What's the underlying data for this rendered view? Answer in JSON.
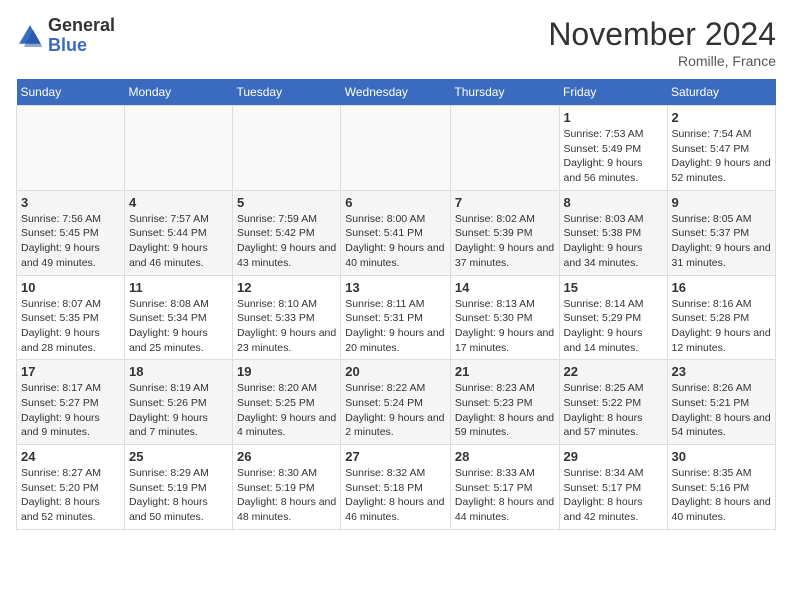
{
  "logo": {
    "general": "General",
    "blue": "Blue"
  },
  "header": {
    "month": "November 2024",
    "location": "Romille, France"
  },
  "weekdays": [
    "Sunday",
    "Monday",
    "Tuesday",
    "Wednesday",
    "Thursday",
    "Friday",
    "Saturday"
  ],
  "weeks": [
    [
      {
        "day": "",
        "info": ""
      },
      {
        "day": "",
        "info": ""
      },
      {
        "day": "",
        "info": ""
      },
      {
        "day": "",
        "info": ""
      },
      {
        "day": "",
        "info": ""
      },
      {
        "day": "1",
        "info": "Sunrise: 7:53 AM\nSunset: 5:49 PM\nDaylight: 9 hours and 56 minutes."
      },
      {
        "day": "2",
        "info": "Sunrise: 7:54 AM\nSunset: 5:47 PM\nDaylight: 9 hours and 52 minutes."
      }
    ],
    [
      {
        "day": "3",
        "info": "Sunrise: 7:56 AM\nSunset: 5:45 PM\nDaylight: 9 hours and 49 minutes."
      },
      {
        "day": "4",
        "info": "Sunrise: 7:57 AM\nSunset: 5:44 PM\nDaylight: 9 hours and 46 minutes."
      },
      {
        "day": "5",
        "info": "Sunrise: 7:59 AM\nSunset: 5:42 PM\nDaylight: 9 hours and 43 minutes."
      },
      {
        "day": "6",
        "info": "Sunrise: 8:00 AM\nSunset: 5:41 PM\nDaylight: 9 hours and 40 minutes."
      },
      {
        "day": "7",
        "info": "Sunrise: 8:02 AM\nSunset: 5:39 PM\nDaylight: 9 hours and 37 minutes."
      },
      {
        "day": "8",
        "info": "Sunrise: 8:03 AM\nSunset: 5:38 PM\nDaylight: 9 hours and 34 minutes."
      },
      {
        "day": "9",
        "info": "Sunrise: 8:05 AM\nSunset: 5:37 PM\nDaylight: 9 hours and 31 minutes."
      }
    ],
    [
      {
        "day": "10",
        "info": "Sunrise: 8:07 AM\nSunset: 5:35 PM\nDaylight: 9 hours and 28 minutes."
      },
      {
        "day": "11",
        "info": "Sunrise: 8:08 AM\nSunset: 5:34 PM\nDaylight: 9 hours and 25 minutes."
      },
      {
        "day": "12",
        "info": "Sunrise: 8:10 AM\nSunset: 5:33 PM\nDaylight: 9 hours and 23 minutes."
      },
      {
        "day": "13",
        "info": "Sunrise: 8:11 AM\nSunset: 5:31 PM\nDaylight: 9 hours and 20 minutes."
      },
      {
        "day": "14",
        "info": "Sunrise: 8:13 AM\nSunset: 5:30 PM\nDaylight: 9 hours and 17 minutes."
      },
      {
        "day": "15",
        "info": "Sunrise: 8:14 AM\nSunset: 5:29 PM\nDaylight: 9 hours and 14 minutes."
      },
      {
        "day": "16",
        "info": "Sunrise: 8:16 AM\nSunset: 5:28 PM\nDaylight: 9 hours and 12 minutes."
      }
    ],
    [
      {
        "day": "17",
        "info": "Sunrise: 8:17 AM\nSunset: 5:27 PM\nDaylight: 9 hours and 9 minutes."
      },
      {
        "day": "18",
        "info": "Sunrise: 8:19 AM\nSunset: 5:26 PM\nDaylight: 9 hours and 7 minutes."
      },
      {
        "day": "19",
        "info": "Sunrise: 8:20 AM\nSunset: 5:25 PM\nDaylight: 9 hours and 4 minutes."
      },
      {
        "day": "20",
        "info": "Sunrise: 8:22 AM\nSunset: 5:24 PM\nDaylight: 9 hours and 2 minutes."
      },
      {
        "day": "21",
        "info": "Sunrise: 8:23 AM\nSunset: 5:23 PM\nDaylight: 8 hours and 59 minutes."
      },
      {
        "day": "22",
        "info": "Sunrise: 8:25 AM\nSunset: 5:22 PM\nDaylight: 8 hours and 57 minutes."
      },
      {
        "day": "23",
        "info": "Sunrise: 8:26 AM\nSunset: 5:21 PM\nDaylight: 8 hours and 54 minutes."
      }
    ],
    [
      {
        "day": "24",
        "info": "Sunrise: 8:27 AM\nSunset: 5:20 PM\nDaylight: 8 hours and 52 minutes."
      },
      {
        "day": "25",
        "info": "Sunrise: 8:29 AM\nSunset: 5:19 PM\nDaylight: 8 hours and 50 minutes."
      },
      {
        "day": "26",
        "info": "Sunrise: 8:30 AM\nSunset: 5:19 PM\nDaylight: 8 hours and 48 minutes."
      },
      {
        "day": "27",
        "info": "Sunrise: 8:32 AM\nSunset: 5:18 PM\nDaylight: 8 hours and 46 minutes."
      },
      {
        "day": "28",
        "info": "Sunrise: 8:33 AM\nSunset: 5:17 PM\nDaylight: 8 hours and 44 minutes."
      },
      {
        "day": "29",
        "info": "Sunrise: 8:34 AM\nSunset: 5:17 PM\nDaylight: 8 hours and 42 minutes."
      },
      {
        "day": "30",
        "info": "Sunrise: 8:35 AM\nSunset: 5:16 PM\nDaylight: 8 hours and 40 minutes."
      }
    ]
  ]
}
